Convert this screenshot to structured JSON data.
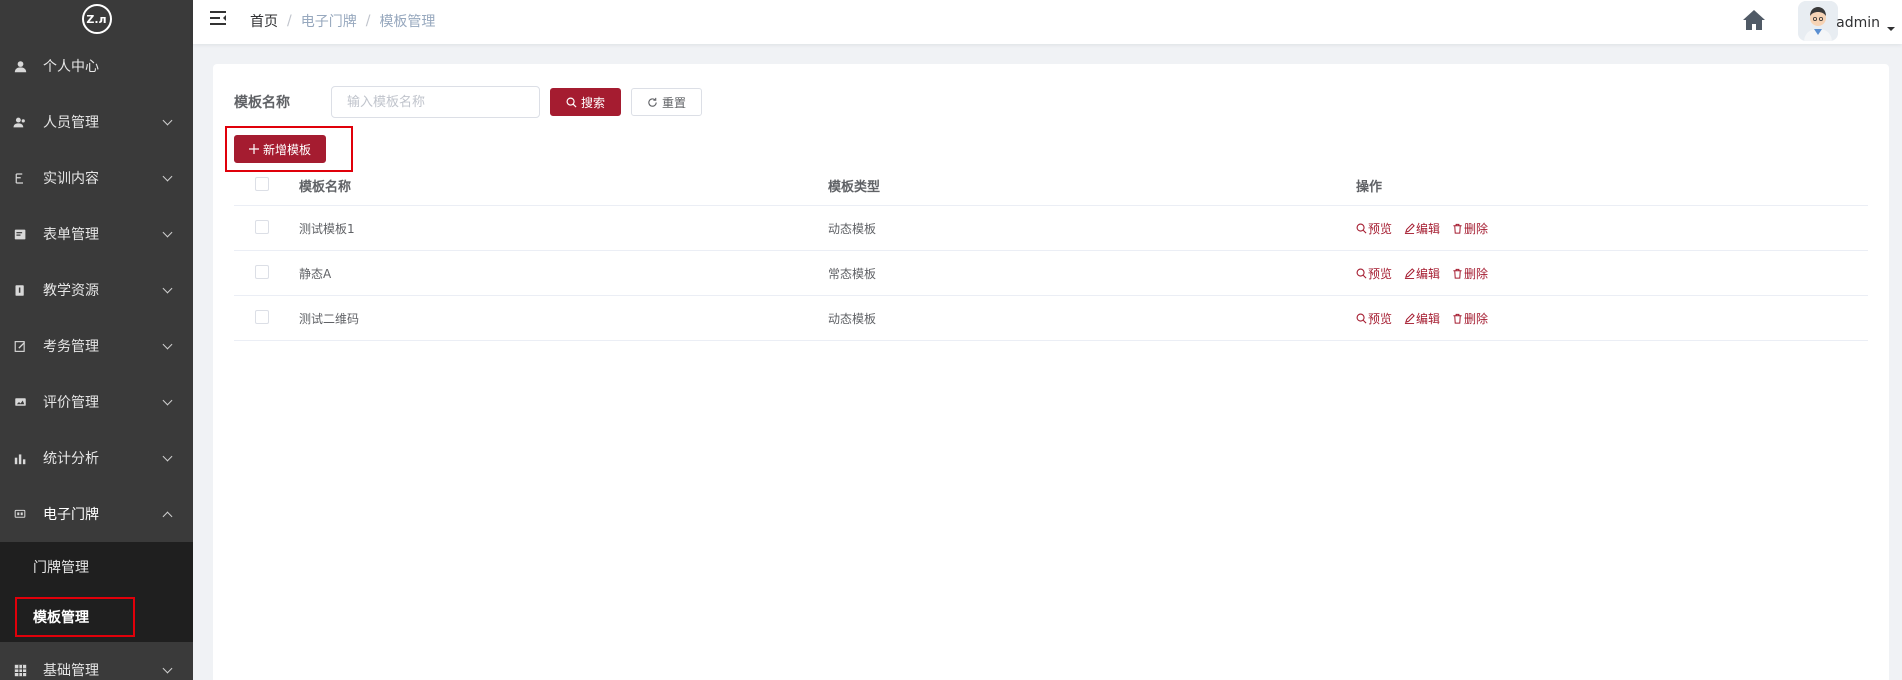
{
  "logo": {
    "text": "Z.л"
  },
  "sidebar": {
    "items": [
      {
        "label": "个人中心",
        "icon": "user-icon",
        "has_arrow": false
      },
      {
        "label": "人员管理",
        "icon": "people-icon",
        "has_arrow": true
      },
      {
        "label": "实训内容",
        "icon": "content-icon",
        "has_arrow": true
      },
      {
        "label": "表单管理",
        "icon": "form-icon",
        "has_arrow": true
      },
      {
        "label": "教学资源",
        "icon": "resource-icon",
        "has_arrow": true
      },
      {
        "label": "考务管理",
        "icon": "exam-icon",
        "has_arrow": true
      },
      {
        "label": "评价管理",
        "icon": "evaluation-icon",
        "has_arrow": true
      },
      {
        "label": "统计分析",
        "icon": "chart-icon",
        "has_arrow": true
      },
      {
        "label": "电子门牌",
        "icon": "screen-icon",
        "has_arrow": true,
        "open": true
      },
      {
        "label": "基础管理",
        "icon": "grid-icon",
        "has_arrow": true
      }
    ],
    "submenu": [
      {
        "label": "门牌管理",
        "active": false
      },
      {
        "label": "模板管理",
        "active": true
      }
    ]
  },
  "header": {
    "breadcrumb": [
      "首页",
      "电子门牌",
      "模板管理"
    ],
    "username": "admin"
  },
  "search": {
    "label": "模板名称",
    "placeholder": "输入模板名称",
    "value": "",
    "search_button": "搜索",
    "reset_button": "重置"
  },
  "add_button": "新增模板",
  "table": {
    "columns": [
      "模板名称",
      "模板类型",
      "操作"
    ],
    "rows": [
      {
        "name": "测试模板1",
        "type": "动态模板"
      },
      {
        "name": "静态A",
        "type": "常态模板"
      },
      {
        "name": "测试二维码",
        "type": "动态模板"
      }
    ],
    "actions": {
      "preview": "预览",
      "edit": "编辑",
      "delete": "删除"
    }
  },
  "colors": {
    "primary": "#a51c30",
    "sidebar_bg": "#3a3a3a",
    "submenu_bg": "#1f1f1f",
    "highlight": "#e0000a"
  }
}
